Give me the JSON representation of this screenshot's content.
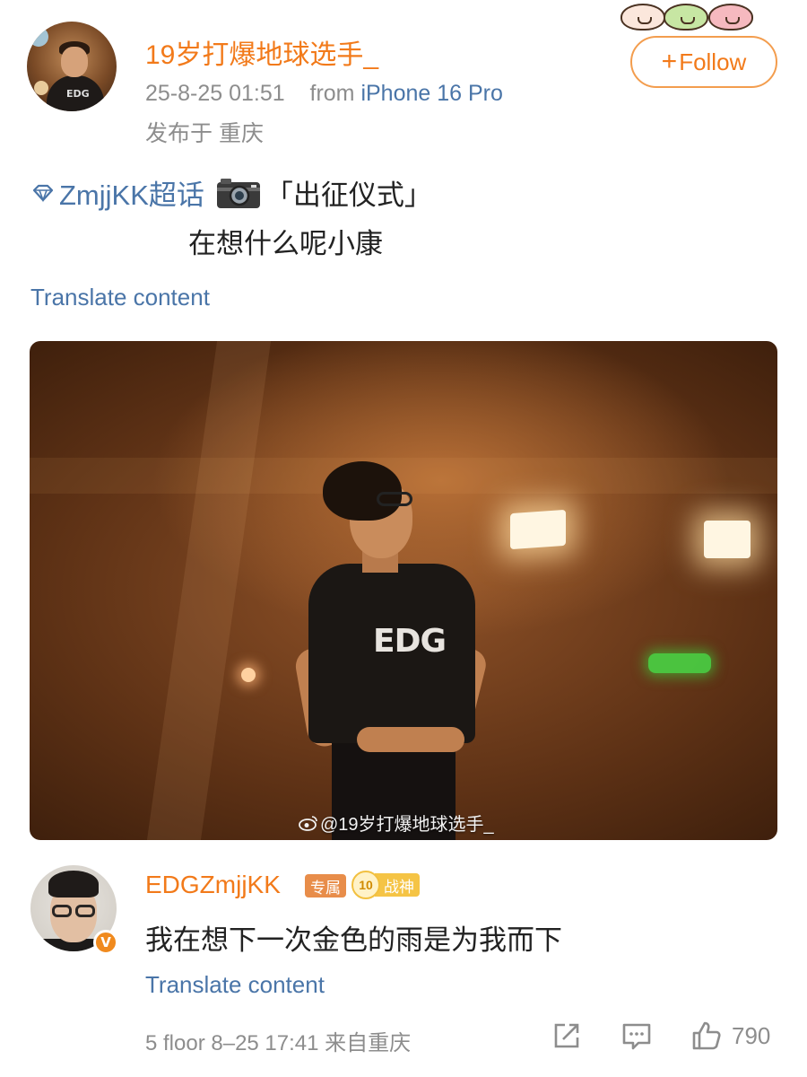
{
  "post": {
    "username": "19岁打爆地球选手_",
    "time": "25-8-25 01:51",
    "from_label": "from",
    "device": "iPhone 16 Pro",
    "location": "发布于 重庆",
    "follow_label": "Follow",
    "topic": "ZmjjKK超话",
    "text_line1": "「出征仪式」",
    "text_line2": "在想什么呢小康",
    "translate_label": "Translate content",
    "watermark": "@19岁打爆地球选手_"
  },
  "comment": {
    "username": "EDGZmjjKK",
    "badge_text": "专属",
    "level_number": "10",
    "level_label": "战神",
    "text": "我在想下一次金色的雨是为我而下",
    "translate_label": "Translate content",
    "floor_meta": "5 floor 8–25 17:41 来自重庆",
    "like_count": "790"
  },
  "colors": {
    "accent_orange": "#f27a1a",
    "link_blue": "#4a75a8",
    "meta_gray": "#8d8d8d"
  },
  "icons": [
    "diamond-icon",
    "camera-icon",
    "weibo-icon",
    "share-icon",
    "comment-icon",
    "like-icon"
  ]
}
